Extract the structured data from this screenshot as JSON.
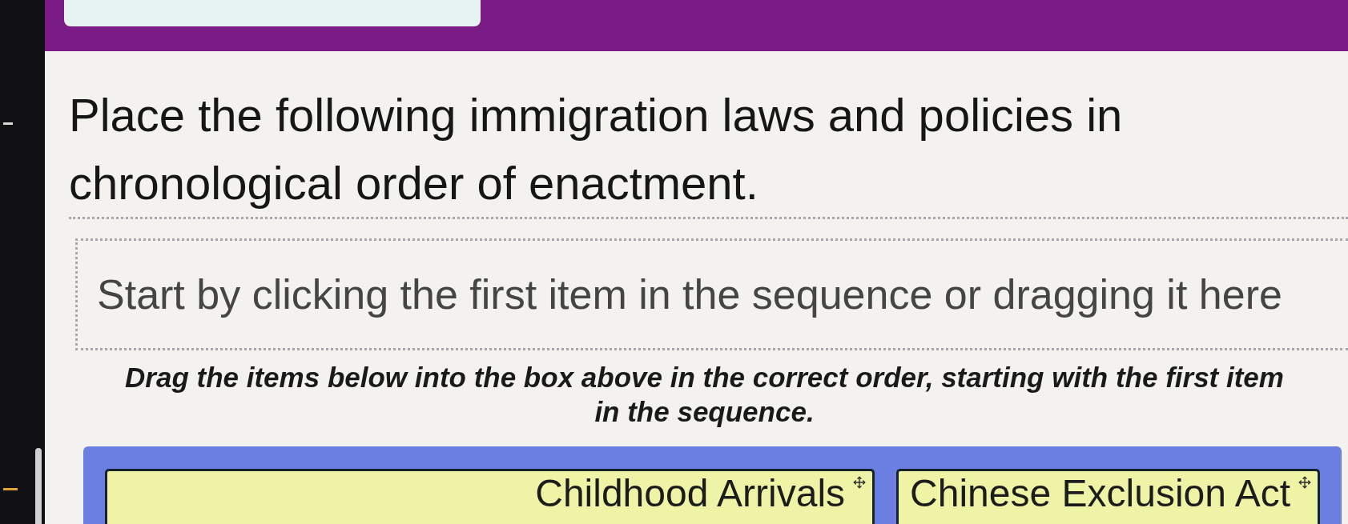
{
  "question": {
    "prompt": "Place the following immigration laws and policies in chronological order of enactment."
  },
  "drop_zone": {
    "prompt": "Start by clicking the first item in the sequence or dragging it here"
  },
  "instructions": "Drag the items below into the box above in the correct order, starting with the first item in the sequence.",
  "items": [
    {
      "label": "Childhood Arrivals"
    },
    {
      "label": "Chinese Exclusion Act"
    }
  ]
}
